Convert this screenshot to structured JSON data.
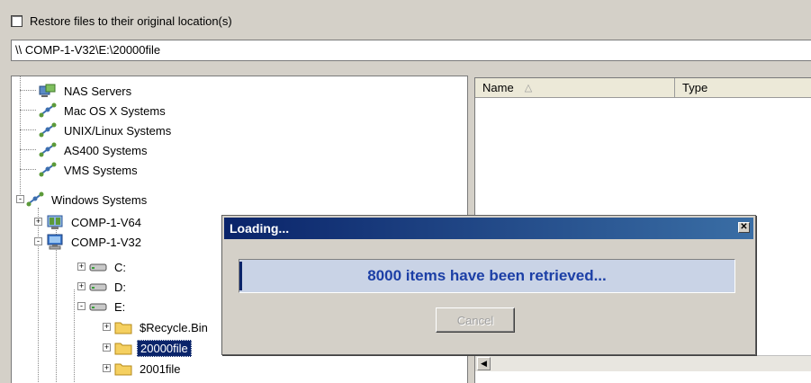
{
  "restore_checkbox": {
    "label": "Restore files to their original location(s)",
    "checked": false
  },
  "path_field": {
    "value": "\\\\ COMP-1-V32\\E:\\20000file"
  },
  "tree": {
    "items": [
      {
        "label": "NAS Servers",
        "icon": "nas-server-icon"
      },
      {
        "label": "Mac OS X Systems",
        "icon": "network-icon"
      },
      {
        "label": "UNIX/Linux Systems",
        "icon": "network-icon"
      },
      {
        "label": "AS400 Systems",
        "icon": "network-icon"
      },
      {
        "label": "VMS Systems",
        "icon": "network-icon"
      },
      {
        "label": "Windows Systems",
        "icon": "network-icon",
        "expander": "-"
      },
      {
        "label": "COMP-1-V64",
        "icon": "server-icon",
        "expander": "+"
      },
      {
        "label": "COMP-1-V32",
        "icon": "computer-icon",
        "expander": "-"
      },
      {
        "label": "C:",
        "icon": "drive-icon",
        "expander": "+"
      },
      {
        "label": "D:",
        "icon": "drive-icon",
        "expander": "+"
      },
      {
        "label": "E:",
        "icon": "drive-icon",
        "expander": "-"
      },
      {
        "label": "$Recycle.Bin",
        "icon": "folder-icon",
        "expander": "+"
      },
      {
        "label": "20000file",
        "icon": "folder-icon",
        "expander": "+",
        "selected": true
      },
      {
        "label": "2001file",
        "icon": "folder-icon",
        "expander": "+"
      }
    ]
  },
  "list": {
    "columns": [
      {
        "label": "Name",
        "sort_icon": "sort-up-icon"
      },
      {
        "label": "Type"
      }
    ]
  },
  "dialog": {
    "title": "Loading...",
    "message": "8000 items have been retrieved...",
    "progress": 0.005,
    "cancel_label": "Cancel",
    "cancel_enabled": false
  },
  "colors": {
    "window_bg": "#d4d0c8",
    "selection_bg": "#0a246a",
    "titlebar_start": "#0a246a",
    "titlebar_end": "#3a6ea5",
    "progress_text": "#1c3fa6"
  }
}
